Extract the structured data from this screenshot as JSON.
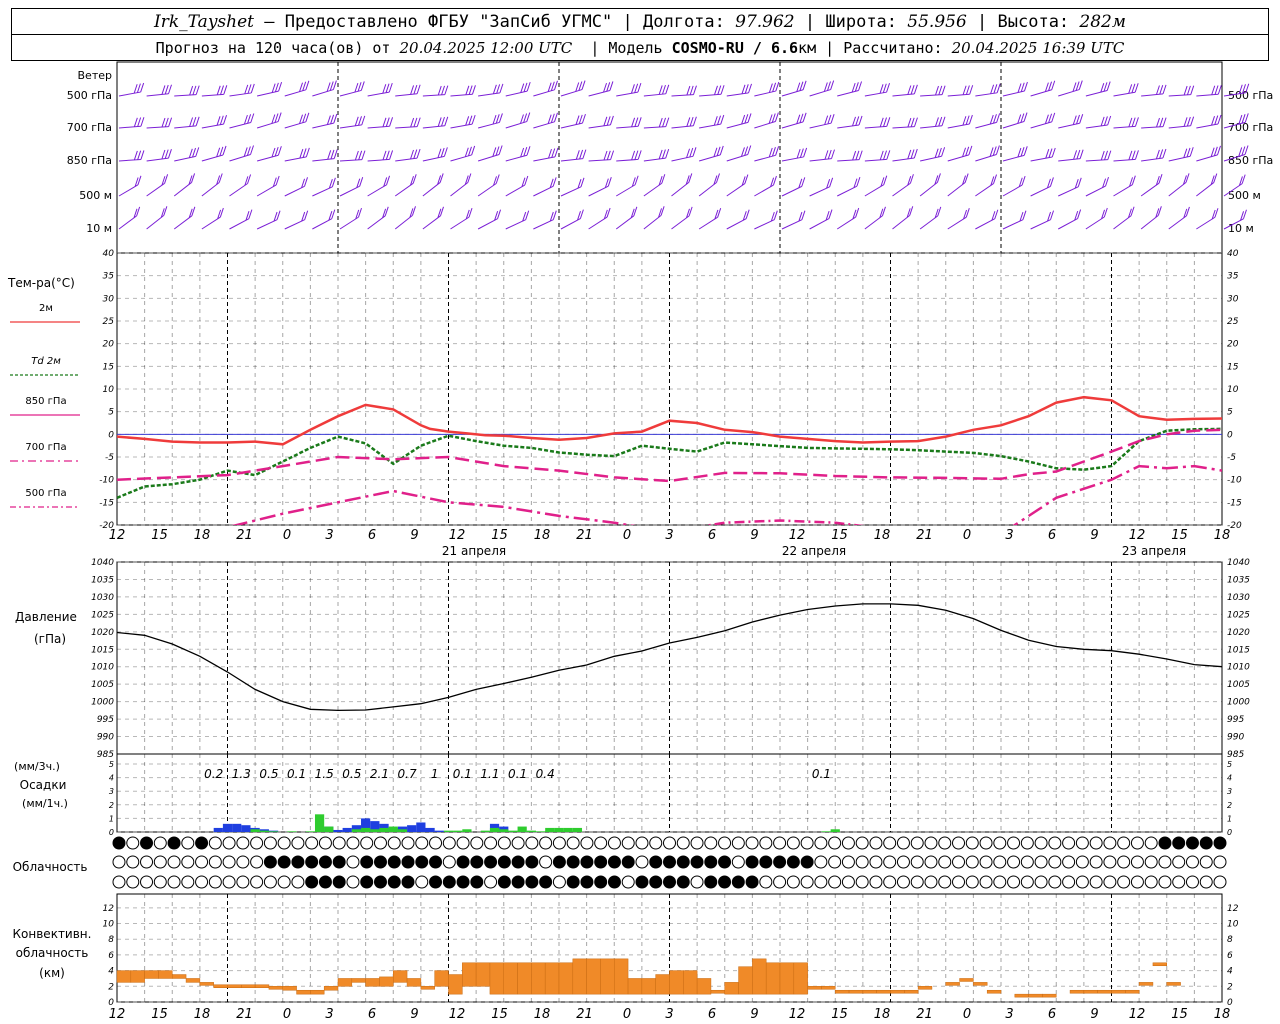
{
  "header": {
    "station": "Irk_Tayshet",
    "dash": "—",
    "provider": "Предоставлено ФГБУ \"ЗапСиб УГМС\"",
    "lon_label": "Долгота:",
    "lon": "97.962",
    "lat_label": "Широта:",
    "lat": "55.956",
    "alt_label": "Высота:",
    "alt": "282м",
    "forecast_label": "Прогноз на 120 часа(ов) от",
    "forecast_start": "20.04.2025 12:00 UTC",
    "model_label": "Модель",
    "model": "COSMO-RU / 6.6",
    "model_unit": "км",
    "computed_label": "Рассчитано:",
    "computed": "20.04.2025 16:39 UTC",
    "sep": "|"
  },
  "time_axis": {
    "hour_labels": [
      "12",
      "15",
      "18",
      "21",
      "0",
      "3",
      "6",
      "9",
      "12",
      "15",
      "18",
      "21",
      "0",
      "3",
      "6",
      "9",
      "12",
      "15",
      "18",
      "21",
      "0",
      "3",
      "6",
      "9",
      "12",
      "15",
      "18"
    ],
    "day_labels": [
      "21 апреля",
      "22 апреля",
      "23 апреля"
    ]
  },
  "colors": {
    "wind": "#7b1fd6",
    "t2m": "#ef3b3b",
    "td2m": "#1a7a1a",
    "t850": "#e0208a",
    "t700": "#e0208a",
    "t500": "#e0208a",
    "pressure": "#000000",
    "precip_conv": "#1f3fe0",
    "precip_large": "#2ecc2e",
    "convective_cloud": "#f08a28"
  },
  "wind_panel": {
    "title": "Ветер",
    "levels": [
      "500 гПа",
      "700 гПа",
      "850 гПа",
      "500 м",
      "10 м"
    ]
  },
  "temp_panel": {
    "title": "Тем-ра(°С)",
    "legend": [
      {
        "label": "2м"
      },
      {
        "label": "Td 2м"
      },
      {
        "label": "850 гПа"
      },
      {
        "label": "700 гПа"
      },
      {
        "label": "500 гПа"
      }
    ]
  },
  "pressure_panel": {
    "title": "Давление",
    "unit": "(гПа)"
  },
  "precip_panel": {
    "unit3": "(мм/3ч.)",
    "title": "Осадки",
    "unit1": "(мм/1ч.)"
  },
  "cloud_panel": {
    "title": "Облачность"
  },
  "conv_panel": {
    "title1": "Конвективн.",
    "title2": "облачность",
    "unit": "(км)"
  },
  "chart_data": [
    {
      "type": "line",
      "title": "Тем-ра(°С)",
      "x_unit": "hours since 20.04.2025 12:00 UTC",
      "ylim": [
        -20,
        40
      ],
      "yticks": [
        -20,
        -15,
        -10,
        -5,
        0,
        5,
        10,
        15,
        20,
        25,
        30,
        35,
        40
      ],
      "series": [
        {
          "name": "2м",
          "x": [
            0,
            3,
            6,
            9,
            12,
            15,
            18,
            21,
            24,
            27,
            30,
            33,
            34,
            36,
            38,
            40,
            42,
            45,
            48,
            51,
            54,
            57,
            60,
            63,
            66,
            69,
            72,
            75,
            78,
            81,
            84,
            87,
            90,
            93,
            96,
            99,
            102,
            105,
            108,
            111,
            114,
            117,
            120
          ],
          "values": [
            -0.5,
            -1,
            -1.6,
            -1.8,
            -1.8,
            -1.6,
            -2.2,
            1,
            4,
            6.5,
            5.5,
            2,
            1.2,
            0.6,
            0.2,
            -0.2,
            -0.3,
            -0.8,
            -1.2,
            -0.8,
            0.2,
            0.6,
            3,
            2.5,
            1,
            0.5,
            -0.5,
            -1,
            -1.5,
            -1.8,
            -1.6,
            -1.5,
            -0.5,
            1,
            2,
            4,
            7,
            8.2,
            7.5,
            4,
            3.2,
            3.4,
            3.5
          ]
        },
        {
          "name": "Td 2м",
          "x": [
            0,
            3,
            6,
            9,
            12,
            15,
            18,
            21,
            24,
            27,
            30,
            33,
            36,
            39,
            42,
            45,
            48,
            51,
            54,
            57,
            60,
            63,
            66,
            69,
            72,
            75,
            78,
            81,
            84,
            87,
            90,
            93,
            96,
            99,
            102,
            105,
            108,
            111,
            114,
            117,
            120
          ],
          "values": [
            -14,
            -11.5,
            -11,
            -10,
            -8,
            -9,
            -6,
            -3,
            -0.5,
            -2,
            -6.5,
            -2.5,
            -0.3,
            -1.5,
            -2.5,
            -3,
            -4,
            -4.5,
            -4.8,
            -2.5,
            -3.2,
            -3.8,
            -1.8,
            -2.2,
            -2.6,
            -3,
            -3.1,
            -3.2,
            -3.3,
            -3.5,
            -3.8,
            -4.1,
            -4.8,
            -6,
            -7.5,
            -7.8,
            -7,
            -1.5,
            0.8,
            1.1,
            1.2
          ]
        },
        {
          "name": "850 гПа",
          "x": [
            0,
            6,
            12,
            18,
            24,
            30,
            36,
            42,
            48,
            54,
            60,
            66,
            72,
            78,
            84,
            90,
            96,
            99,
            102,
            105,
            108,
            111,
            114,
            117,
            120
          ],
          "values": [
            -10,
            -9.5,
            -9,
            -7,
            -5,
            -5.5,
            -5,
            -7,
            -8,
            -9.5,
            -10.3,
            -8.5,
            -8.6,
            -9.2,
            -9.5,
            -9.6,
            -9.8,
            -8.8,
            -8.2,
            -6,
            -3.8,
            -1.5,
            0,
            0.8,
            1
          ]
        },
        {
          "name": "700 гПа",
          "x": [
            0,
            6,
            12,
            18,
            24,
            30,
            36,
            42,
            48,
            54,
            60,
            66,
            72,
            78,
            84,
            90,
            96,
            102,
            108,
            111,
            114,
            117,
            120
          ],
          "values": [
            -24,
            -22,
            -20.5,
            -17.5,
            -15,
            -12.5,
            -15,
            -16,
            -18,
            -19.5,
            -21.5,
            -22,
            -23,
            -25,
            -25.5,
            -25,
            -22,
            -14,
            -10,
            -7,
            -7.5,
            -7,
            -8
          ]
        },
        {
          "name": "500 гПа",
          "x": [
            0,
            12,
            24,
            36,
            48,
            60,
            66,
            72,
            78,
            84,
            90,
            96,
            102,
            108,
            114,
            120
          ],
          "values": [
            -30,
            -30,
            -28,
            -25,
            -23,
            -21.5,
            -19.5,
            -19,
            -19.5,
            -21,
            -23,
            -26,
            -27,
            -28,
            -29,
            -30
          ]
        }
      ]
    },
    {
      "type": "line",
      "title": "Давление",
      "ylabel": "(гПа)",
      "ylim": [
        985,
        1040
      ],
      "yticks": [
        985,
        990,
        995,
        1000,
        1005,
        1010,
        1015,
        1020,
        1025,
        1030,
        1035,
        1040
      ],
      "series": [
        {
          "name": "Давление",
          "x": [
            0,
            3,
            6,
            9,
            12,
            15,
            18,
            21,
            24,
            27,
            30,
            33,
            36,
            39,
            42,
            45,
            48,
            51,
            54,
            57,
            60,
            63,
            66,
            69,
            72,
            75,
            78,
            81,
            84,
            87,
            90,
            93,
            96,
            99,
            102,
            105,
            108,
            111,
            114,
            117,
            120
          ],
          "values": [
            1019.8,
            1019,
            1016.5,
            1013,
            1008.5,
            1003.5,
            1000,
            997.8,
            997.5,
            997.6,
            998.5,
            999.4,
            1001.2,
            1003.5,
            1005.2,
            1007,
            1009,
            1010.5,
            1013,
            1014.5,
            1016.8,
            1018.4,
            1020.3,
            1022.8,
            1024.8,
            1026.4,
            1027.4,
            1028,
            1028,
            1027.6,
            1026.2,
            1023.8,
            1020.4,
            1017.6,
            1015.8,
            1015,
            1014.6,
            1013.6,
            1012.2,
            1010.6,
            1010
          ]
        }
      ]
    },
    {
      "type": "bar",
      "title": "Осадки",
      "ylabel": "(мм/1ч.)",
      "ylim": [
        0,
        5
      ],
      "totals_3h": [
        {
          "x": 10.5,
          "label": "0.2"
        },
        {
          "x": 13.5,
          "label": "1.3"
        },
        {
          "x": 16.5,
          "label": "0.5"
        },
        {
          "x": 19.5,
          "label": "0.1"
        },
        {
          "x": 22.5,
          "label": "1.5"
        },
        {
          "x": 25.5,
          "label": "0.5"
        },
        {
          "x": 28.5,
          "label": "2.1"
        },
        {
          "x": 31.5,
          "label": "0.7"
        },
        {
          "x": 34.5,
          "label": "1"
        },
        {
          "x": 37.5,
          "label": "0.1"
        },
        {
          "x": 40.5,
          "label": "1.1"
        },
        {
          "x": 43.5,
          "label": "0.1"
        },
        {
          "x": 46.5,
          "label": "0.4"
        },
        {
          "x": 76.5,
          "label": "0.1"
        }
      ],
      "series": [
        {
          "name": "conv",
          "x": [
            11,
            12,
            13,
            14,
            15,
            16,
            17,
            23,
            24,
            25,
            26,
            27,
            28,
            29,
            30,
            31,
            32,
            33,
            34,
            35,
            41,
            42
          ],
          "values": [
            0.3,
            0.6,
            0.6,
            0.5,
            0.3,
            0.2,
            0.1,
            0.4,
            0.15,
            0.3,
            0.5,
            1,
            0.8,
            0.6,
            0.3,
            0.4,
            0.5,
            0.7,
            0.3,
            0.1,
            0.6,
            0.4
          ]
        },
        {
          "name": "large",
          "x": [
            15,
            16,
            17,
            19,
            21,
            22,
            23,
            26,
            27,
            28,
            29,
            30,
            31,
            36,
            37,
            38,
            40,
            41,
            42,
            43,
            44,
            45,
            46,
            47,
            48,
            49,
            50,
            77,
            78
          ],
          "values": [
            0.2,
            0.1,
            0.05,
            0.05,
            0.05,
            1.3,
            0.4,
            0.2,
            0.3,
            0.2,
            0.3,
            0.4,
            0.2,
            0.1,
            0.1,
            0.2,
            0.1,
            0.3,
            0.2,
            0.1,
            0.4,
            0.1,
            0.05,
            0.3,
            0.3,
            0.3,
            0.3,
            0.05,
            0.2
          ]
        }
      ]
    },
    {
      "type": "bar",
      "title": "Конвективн. облачность",
      "ylabel": "(км)",
      "ylim": [
        0,
        13
      ],
      "series": [
        {
          "name": "base_top_km",
          "x": [
            1,
            2,
            3,
            4,
            5,
            6,
            7,
            8,
            9,
            10,
            11,
            12,
            13,
            14,
            15,
            16,
            17,
            18,
            19,
            20,
            21,
            22,
            23,
            24,
            25,
            26,
            27,
            28,
            29,
            30,
            31,
            32,
            33,
            34,
            35,
            36,
            37,
            38,
            39,
            40,
            41,
            42,
            43,
            44,
            45,
            46,
            47,
            48,
            49,
            50,
            51,
            52,
            53,
            54,
            55,
            56,
            57,
            58,
            59,
            61,
            62,
            63,
            64,
            66,
            67,
            68,
            70,
            71,
            72,
            73,
            74,
            75,
            76,
            77
          ],
          "base": [
            2.5,
            2.5,
            3,
            3,
            3,
            2.5,
            2.5,
            2,
            2,
            2,
            2,
            1.8,
            1.5,
            1,
            1,
            1.5,
            2,
            2.5,
            2,
            2,
            2.5,
            2,
            2,
            2,
            1,
            2,
            2,
            1,
            1,
            1,
            1,
            1,
            1,
            1,
            1,
            1,
            1,
            1,
            1,
            1,
            1,
            1,
            1,
            1.5,
            1,
            1,
            1,
            1,
            1,
            1,
            2,
            2,
            1.5,
            1.5,
            1.5,
            1.5,
            1.5,
            1.5,
            2,
            2.5,
            3,
            2.5,
            1.5,
            1,
            1,
            1,
            1.5,
            1.5,
            1.5,
            1.5,
            1.5,
            2.5,
            5,
            2.5
          ],
          "top": [
            4,
            4,
            4,
            4,
            3.5,
            3,
            2.5,
            2.2,
            2.2,
            2.2,
            2.2,
            2,
            2,
            1.5,
            1.5,
            2,
            3,
            3,
            3,
            3.2,
            4,
            3,
            2,
            4,
            3.5,
            5,
            5,
            5,
            5,
            5,
            5,
            5,
            5,
            5.5,
            5.5,
            5.5,
            5.5,
            3,
            3,
            3.5,
            4,
            4,
            3,
            1.5,
            2.5,
            4.5,
            5.5,
            5,
            5,
            5,
            2,
            2,
            1.5,
            1.5,
            1.5,
            1.5,
            1.5,
            1.5,
            2,
            2.5,
            3,
            2.5,
            1.5,
            1,
            1,
            1,
            1.5,
            1.5,
            1.5,
            1.5,
            1.5,
            2.5,
            5,
            2.5
          ]
        }
      ]
    }
  ]
}
